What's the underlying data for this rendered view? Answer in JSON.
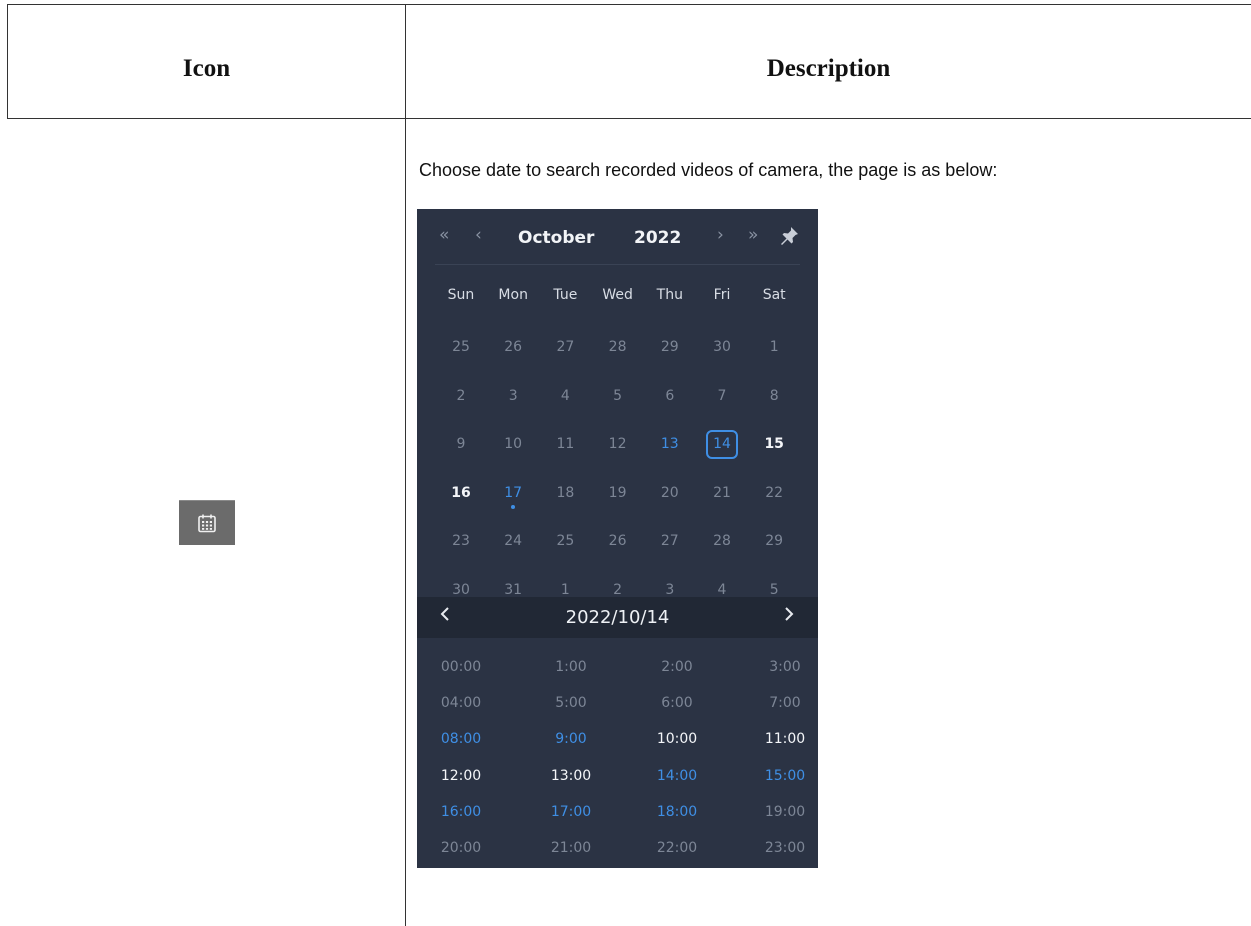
{
  "table": {
    "headers": {
      "icon": "Icon",
      "description": "Description"
    },
    "row": {
      "icon_name": "calendar-icon",
      "description": "Choose date to search recorded videos of camera, the page is as below:"
    }
  },
  "calendar": {
    "nav": {
      "prev_year": "«",
      "prev_month": "‹",
      "next_month": "›",
      "next_year": "»",
      "pin_icon": "pin-icon"
    },
    "month": "October",
    "year": "2022",
    "weekdays": [
      "Sun",
      "Mon",
      "Tue",
      "Wed",
      "Thu",
      "Fri",
      "Sat"
    ],
    "weeks": [
      [
        {
          "d": "25",
          "s": "other"
        },
        {
          "d": "26",
          "s": "other"
        },
        {
          "d": "27",
          "s": "other"
        },
        {
          "d": "28",
          "s": "other"
        },
        {
          "d": "29",
          "s": "other"
        },
        {
          "d": "30",
          "s": "other"
        },
        {
          "d": "1",
          "s": "normal"
        }
      ],
      [
        {
          "d": "2",
          "s": "normal"
        },
        {
          "d": "3",
          "s": "normal"
        },
        {
          "d": "4",
          "s": "normal"
        },
        {
          "d": "5",
          "s": "normal"
        },
        {
          "d": "6",
          "s": "normal"
        },
        {
          "d": "7",
          "s": "normal"
        },
        {
          "d": "8",
          "s": "normal"
        }
      ],
      [
        {
          "d": "9",
          "s": "normal"
        },
        {
          "d": "10",
          "s": "normal"
        },
        {
          "d": "11",
          "s": "normal"
        },
        {
          "d": "12",
          "s": "normal"
        },
        {
          "d": "13",
          "s": "recorded"
        },
        {
          "d": "14",
          "s": "selected"
        },
        {
          "d": "15",
          "s": "current"
        }
      ],
      [
        {
          "d": "16",
          "s": "current"
        },
        {
          "d": "17",
          "s": "today"
        },
        {
          "d": "18",
          "s": "normal"
        },
        {
          "d": "19",
          "s": "normal"
        },
        {
          "d": "20",
          "s": "normal"
        },
        {
          "d": "21",
          "s": "normal"
        },
        {
          "d": "22",
          "s": "normal"
        }
      ],
      [
        {
          "d": "23",
          "s": "normal"
        },
        {
          "d": "24",
          "s": "normal"
        },
        {
          "d": "25",
          "s": "normal"
        },
        {
          "d": "26",
          "s": "normal"
        },
        {
          "d": "27",
          "s": "normal"
        },
        {
          "d": "28",
          "s": "normal"
        },
        {
          "d": "29",
          "s": "normal"
        }
      ],
      [
        {
          "d": "30",
          "s": "normal"
        },
        {
          "d": "31",
          "s": "normal"
        },
        {
          "d": "1",
          "s": "other"
        },
        {
          "d": "2",
          "s": "other"
        },
        {
          "d": "3",
          "s": "other"
        },
        {
          "d": "4",
          "s": "other"
        },
        {
          "d": "5",
          "s": "other"
        }
      ]
    ],
    "selected_date": "2022/10/14",
    "hours": [
      {
        "t": "00:00",
        "s": "none"
      },
      {
        "t": "1:00",
        "s": "none"
      },
      {
        "t": "2:00",
        "s": "none"
      },
      {
        "t": "3:00",
        "s": "none"
      },
      {
        "t": "04:00",
        "s": "none"
      },
      {
        "t": "5:00",
        "s": "none"
      },
      {
        "t": "6:00",
        "s": "none"
      },
      {
        "t": "7:00",
        "s": "none"
      },
      {
        "t": "08:00",
        "s": "recorded"
      },
      {
        "t": "9:00",
        "s": "recorded"
      },
      {
        "t": "10:00",
        "s": "available"
      },
      {
        "t": "11:00",
        "s": "available"
      },
      {
        "t": "12:00",
        "s": "available"
      },
      {
        "t": "13:00",
        "s": "available"
      },
      {
        "t": "14:00",
        "s": "recorded"
      },
      {
        "t": "15:00",
        "s": "recorded"
      },
      {
        "t": "16:00",
        "s": "recorded"
      },
      {
        "t": "17:00",
        "s": "recorded"
      },
      {
        "t": "18:00",
        "s": "recorded"
      },
      {
        "t": "19:00",
        "s": "none"
      },
      {
        "t": "20:00",
        "s": "none"
      },
      {
        "t": "21:00",
        "s": "none"
      },
      {
        "t": "22:00",
        "s": "none"
      },
      {
        "t": "23:00",
        "s": "none"
      }
    ],
    "colors": {
      "background": "#2b3344",
      "accent": "#3f8fe5",
      "datebar": "#212835"
    }
  }
}
